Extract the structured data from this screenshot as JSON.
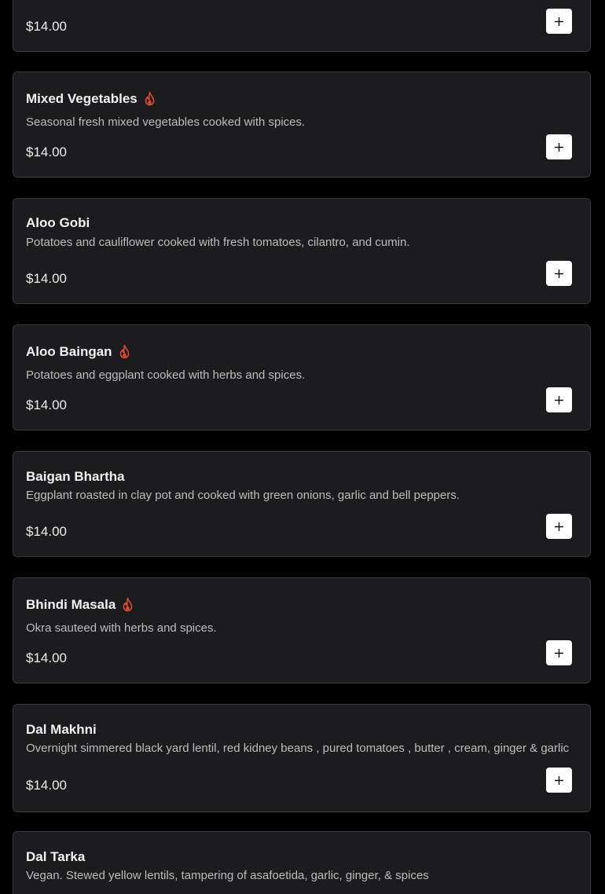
{
  "accent_color": "#e04a2f",
  "add_button_icon": "plus-icon",
  "spicy_icon": "flame-icon",
  "menu_items": [
    {
      "name": "",
      "spicy": false,
      "description": "",
      "price": "$14.00"
    },
    {
      "name": "Mixed Vegetables",
      "spicy": true,
      "description": "Seasonal fresh mixed vegetables cooked with spices.",
      "price": "$14.00"
    },
    {
      "name": "Aloo Gobi",
      "spicy": false,
      "description": "Potatoes and cauliflower cooked with fresh tomatoes, cilantro, and cumin.",
      "price": "$14.00"
    },
    {
      "name": "Aloo Baingan",
      "spicy": true,
      "description": "Potatoes and eggplant cooked with herbs and spices.",
      "price": "$14.00"
    },
    {
      "name": "Baigan Bhartha",
      "spicy": false,
      "description": "Eggplant roasted in clay pot and cooked with green onions, garlic and bell peppers.",
      "price": "$14.00"
    },
    {
      "name": "Bhindi Masala",
      "spicy": true,
      "description": "Okra sauteed with herbs and spices.",
      "price": "$14.00"
    },
    {
      "name": "Dal Makhni",
      "spicy": false,
      "description": "Overnight simmered black yard lentil, red kidney beans , pured tomatoes , butter , cream, ginger & garlic",
      "price": "$14.00"
    },
    {
      "name": "Dal Tarka",
      "spicy": false,
      "description": "Vegan. Stewed yellow lentils, tampering of asafoetida, garlic, ginger, & spices",
      "price": ""
    }
  ]
}
